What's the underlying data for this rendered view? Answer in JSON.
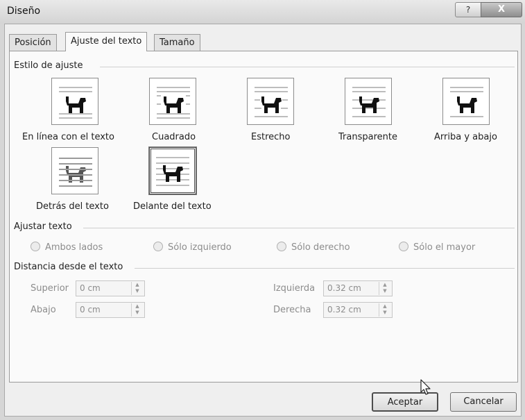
{
  "window": {
    "title": "Diseño",
    "help_label": "?",
    "close_label": "X"
  },
  "tabs": [
    {
      "label": "Posición",
      "active": false
    },
    {
      "label": "Ajuste del texto",
      "active": true
    },
    {
      "label": "Tamaño",
      "active": false
    }
  ],
  "wrap_style": {
    "header": "Estilo de ajuste",
    "options": [
      {
        "label": "En línea con el texto",
        "icon": "inline-dog-icon",
        "selected": false
      },
      {
        "label": "Cuadrado",
        "icon": "square-wrap-dog-icon",
        "selected": false
      },
      {
        "label": "Estrecho",
        "icon": "tight-wrap-dog-icon",
        "selected": false
      },
      {
        "label": "Transparente",
        "icon": "through-wrap-dog-icon",
        "selected": false
      },
      {
        "label": "Arriba y abajo",
        "icon": "top-bottom-dog-icon",
        "selected": false
      },
      {
        "label": "Detrás del texto",
        "icon": "behind-text-dog-icon",
        "selected": false
      },
      {
        "label": "Delante del texto",
        "icon": "in-front-text-dog-icon",
        "selected": true
      }
    ]
  },
  "wrap_text": {
    "header": "Ajustar texto",
    "options": [
      "Ambos lados",
      "Sólo izquierdo",
      "Sólo derecho",
      "Sólo el mayor"
    ]
  },
  "distance": {
    "header": "Distancia desde el texto",
    "superior": {
      "label": "Superior",
      "value": "0 cm"
    },
    "abajo": {
      "label": "Abajo",
      "value": "0 cm"
    },
    "izquierda": {
      "label": "Izquierda",
      "value": "0.32 cm"
    },
    "derecha": {
      "label": "Derecha",
      "value": "0.32 cm"
    }
  },
  "buttons": {
    "ok": "Aceptar",
    "cancel": "Cancelar"
  }
}
